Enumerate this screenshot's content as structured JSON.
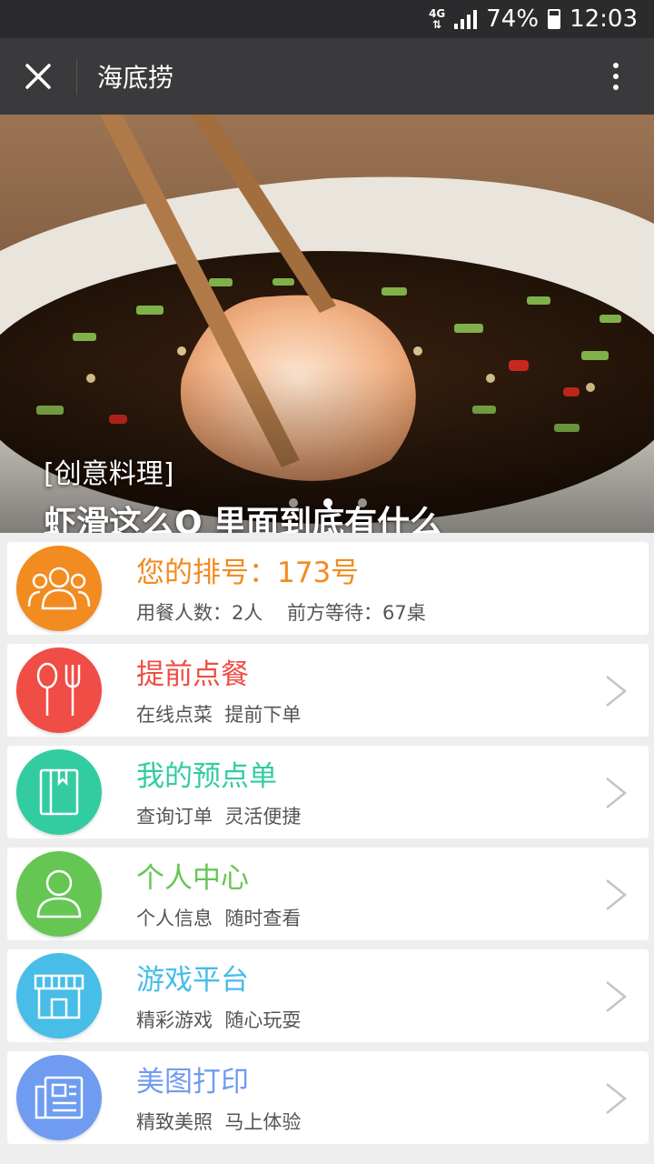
{
  "status_bar": {
    "network": "4G",
    "battery": "74%",
    "time": "12:03"
  },
  "header": {
    "title": "海底捞"
  },
  "banner": {
    "tag": "[创意料理]",
    "caption": "虾滑这么Q 里面到底有什么"
  },
  "queue": {
    "title": "您的排号：173号",
    "subtitle": "用餐人数：2人    前方等待：67桌",
    "color": "#f28b20"
  },
  "menu": [
    {
      "title": "提前点餐",
      "subtitle": "在线点菜  提前下单",
      "color": "#ef4d45",
      "icon": "spoon-fork-icon"
    },
    {
      "title": "我的预点单",
      "subtitle": "查询订单  灵活便捷",
      "color": "#33cca0",
      "icon": "notebook-icon"
    },
    {
      "title": "个人中心",
      "subtitle": "个人信息  随时查看",
      "color": "#66c654",
      "icon": "person-icon"
    },
    {
      "title": "游戏平台",
      "subtitle": "精彩游戏  随心玩耍",
      "color": "#47bde8",
      "icon": "store-icon"
    },
    {
      "title": "美图打印",
      "subtitle": "精致美照  马上体验",
      "color": "#6f9cf0",
      "icon": "photo-print-icon"
    }
  ]
}
